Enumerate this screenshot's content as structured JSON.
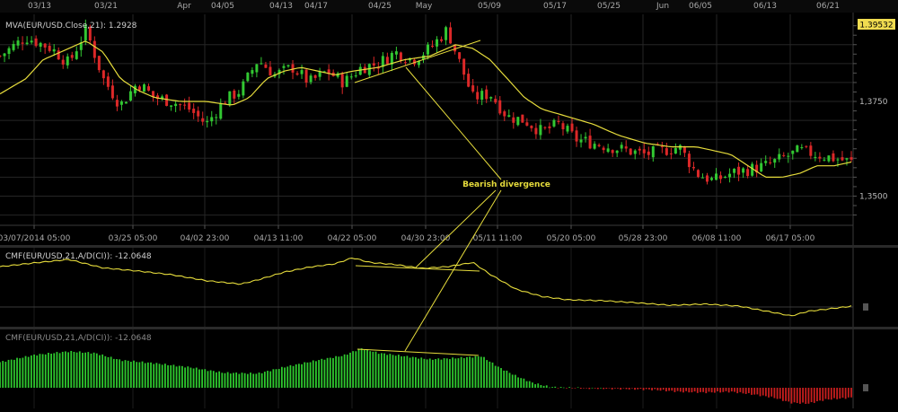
{
  "top_axis": {
    "labels": [
      "03/13",
      "03/21",
      "Apr",
      "04/05",
      "04/13",
      "04/17",
      "04/25",
      "May",
      "05/09",
      "05/17",
      "05/25",
      "Jun",
      "06/05",
      "06/13",
      "06/21"
    ]
  },
  "bottom_axis": {
    "labels": [
      "03/07/2014 05:00",
      "03/25 05:00",
      "04/02 23:00",
      "04/13 11:00",
      "04/22 05:00",
      "04/30 23:00",
      "05/11 11:00",
      "05/20 05:00",
      "05/28 23:00",
      "06/08 11:00",
      "06/17 05:00"
    ]
  },
  "price_panel": {
    "label": "MVA(EUR/USD.Close,21): 1.2928",
    "current_price": "1.39532",
    "price_ticks": [
      "1,3750",
      "1,3500"
    ]
  },
  "cmf_line_panel": {
    "label": "CMF(EUR/USD,21,A/D(CI)): -12.0648"
  },
  "cmf_hist_panel": {
    "label": "CMF(EUR/USD,21,A/D(CI)): -12.0648"
  },
  "annotation": {
    "text": "Bearish divergence"
  },
  "colors": {
    "up_candle": "#32c832",
    "down_candle": "#dc2828",
    "ma_line": "#e6dc3c",
    "cmf_line": "#e6dc3c",
    "hist_positive": "#2ec82e",
    "hist_negative": "#c81e1e",
    "grid": "#262626",
    "annotation": "#e6dc3c",
    "marker": "#c8a03c",
    "price_badge": "#f0dc50"
  },
  "chart_data": [
    {
      "type": "candlestick",
      "title": "MVA(EUR/USD.Close,21): 1.2928",
      "x_start": "03/07/2014 05:00",
      "x_end": "06/21",
      "ylim": [
        1.343,
        1.398
      ],
      "ytick_values": [
        1.375,
        1.35
      ],
      "current_price": 1.39532,
      "close_path": [
        [
          0,
          1.387
        ],
        [
          3,
          1.392
        ],
        [
          6,
          1.389
        ],
        [
          8,
          1.385
        ],
        [
          10,
          1.394
        ],
        [
          12,
          1.381
        ],
        [
          14,
          1.374
        ],
        [
          16,
          1.38
        ],
        [
          18,
          1.376
        ],
        [
          20,
          1.375
        ],
        [
          22,
          1.373
        ],
        [
          24,
          1.369
        ],
        [
          26,
          1.375
        ],
        [
          28,
          1.378
        ],
        [
          30,
          1.386
        ],
        [
          32,
          1.382
        ],
        [
          34,
          1.384
        ],
        [
          36,
          1.38
        ],
        [
          38,
          1.383
        ],
        [
          40,
          1.38
        ],
        [
          42,
          1.384
        ],
        [
          44,
          1.385
        ],
        [
          46,
          1.388
        ],
        [
          48,
          1.386
        ],
        [
          50,
          1.389
        ],
        [
          52,
          1.394
        ],
        [
          54,
          1.382
        ],
        [
          55,
          1.376
        ],
        [
          57,
          1.377
        ],
        [
          59,
          1.371
        ],
        [
          61,
          1.37
        ],
        [
          63,
          1.367
        ],
        [
          65,
          1.369
        ],
        [
          67,
          1.365
        ],
        [
          69,
          1.364
        ],
        [
          71,
          1.363
        ],
        [
          73,
          1.362
        ],
        [
          75,
          1.361
        ],
        [
          77,
          1.362
        ],
        [
          79,
          1.363
        ],
        [
          81,
          1.356
        ],
        [
          83,
          1.354
        ],
        [
          85,
          1.356
        ],
        [
          87,
          1.357
        ],
        [
          89,
          1.358
        ],
        [
          91,
          1.36
        ],
        [
          93,
          1.362
        ],
        [
          95,
          1.361
        ],
        [
          97,
          1.36
        ],
        [
          99,
          1.359
        ]
      ],
      "ma_path": [
        [
          0,
          1.377
        ],
        [
          3,
          1.381
        ],
        [
          5,
          1.386
        ],
        [
          8,
          1.389
        ],
        [
          10,
          1.391
        ],
        [
          12,
          1.388
        ],
        [
          14,
          1.381
        ],
        [
          16,
          1.378
        ],
        [
          18,
          1.376
        ],
        [
          21,
          1.375
        ],
        [
          24,
          1.375
        ],
        [
          27,
          1.374
        ],
        [
          29,
          1.376
        ],
        [
          31,
          1.381
        ],
        [
          33,
          1.383
        ],
        [
          35,
          1.384
        ],
        [
          37,
          1.383
        ],
        [
          39,
          1.382
        ],
        [
          41,
          1.383
        ],
        [
          44,
          1.384
        ],
        [
          47,
          1.386
        ],
        [
          50,
          1.387
        ],
        [
          53,
          1.39
        ],
        [
          55,
          1.389
        ],
        [
          57,
          1.386
        ],
        [
          59,
          1.381
        ],
        [
          61,
          1.376
        ],
        [
          63,
          1.373
        ],
        [
          66,
          1.371
        ],
        [
          69,
          1.369
        ],
        [
          72,
          1.366
        ],
        [
          75,
          1.364
        ],
        [
          78,
          1.363
        ],
        [
          81,
          1.363
        ],
        [
          83,
          1.362
        ],
        [
          85,
          1.361
        ],
        [
          87,
          1.358
        ],
        [
          89,
          1.355
        ],
        [
          91,
          1.355
        ],
        [
          93,
          1.356
        ],
        [
          95,
          1.358
        ],
        [
          97,
          1.358
        ],
        [
          99,
          1.359
        ]
      ]
    },
    {
      "type": "line",
      "title": "CMF(EUR/USD,21,A/D(CI)): -12.0648",
      "series": [
        {
          "values": [
            [
              0,
              0.73
            ],
            [
              4,
              0.82
            ],
            [
              8,
              0.9
            ],
            [
              12,
              0.7
            ],
            [
              16,
              0.63
            ],
            [
              20,
              0.54
            ],
            [
              24,
              0.4
            ],
            [
              28,
              0.32
            ],
            [
              30,
              0.42
            ],
            [
              33,
              0.6
            ],
            [
              36,
              0.72
            ],
            [
              39,
              0.8
            ],
            [
              41,
              0.94
            ],
            [
              43,
              0.83
            ],
            [
              46,
              0.78
            ],
            [
              49,
              0.69
            ],
            [
              52,
              0.73
            ],
            [
              55,
              0.83
            ],
            [
              57,
              0.55
            ],
            [
              60,
              0.2
            ],
            [
              63,
              0.03
            ],
            [
              66,
              -0.05
            ],
            [
              70,
              -0.07
            ],
            [
              74,
              -0.12
            ],
            [
              78,
              -0.18
            ],
            [
              82,
              -0.15
            ],
            [
              86,
              -0.2
            ],
            [
              90,
              -0.35
            ],
            [
              92,
              -0.43
            ],
            [
              94,
              -0.32
            ],
            [
              97,
              -0.25
            ],
            [
              99,
              -0.2
            ]
          ]
        }
      ]
    },
    {
      "type": "bar",
      "title": "CMF(EUR/USD,21,A/D(CI)): -12.0648",
      "ylim": [
        -0.45,
        1.0
      ],
      "profile": [
        [
          0,
          0.65
        ],
        [
          4,
          0.83
        ],
        [
          8,
          0.92
        ],
        [
          11,
          0.88
        ],
        [
          14,
          0.7
        ],
        [
          18,
          0.62
        ],
        [
          22,
          0.52
        ],
        [
          26,
          0.38
        ],
        [
          30,
          0.36
        ],
        [
          33,
          0.52
        ],
        [
          37,
          0.7
        ],
        [
          40,
          0.82
        ],
        [
          42,
          1.0
        ],
        [
          44,
          0.88
        ],
        [
          47,
          0.8
        ],
        [
          50,
          0.72
        ],
        [
          53,
          0.75
        ],
        [
          56,
          0.8
        ],
        [
          58,
          0.52
        ],
        [
          60,
          0.3
        ],
        [
          62,
          0.12
        ],
        [
          64,
          0.02
        ],
        [
          66,
          0.0
        ],
        [
          70,
          -0.02
        ],
        [
          73,
          -0.03
        ],
        [
          76,
          -0.05
        ],
        [
          79,
          -0.1
        ],
        [
          82,
          -0.12
        ],
        [
          85,
          -0.1
        ],
        [
          88,
          -0.18
        ],
        [
          90,
          -0.25
        ],
        [
          92,
          -0.38
        ],
        [
          94,
          -0.4
        ],
        [
          96,
          -0.3
        ],
        [
          99,
          -0.25
        ]
      ]
    }
  ]
}
